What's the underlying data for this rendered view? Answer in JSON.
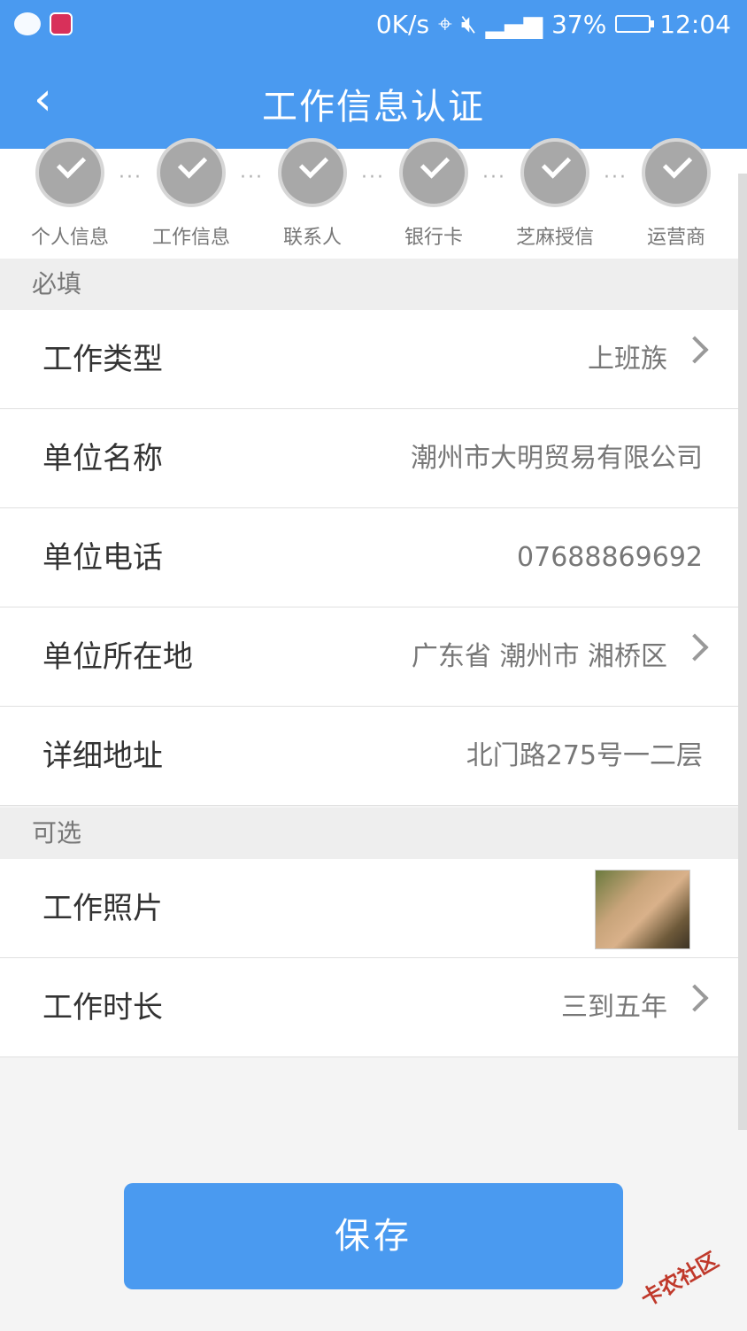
{
  "status_bar": {
    "speed": "0K/s",
    "battery_percent": "37%",
    "time": "12:04"
  },
  "header": {
    "title": "工作信息认证"
  },
  "steps": [
    {
      "label": "个人信息"
    },
    {
      "label": "工作信息"
    },
    {
      "label": "联系人"
    },
    {
      "label": "银行卡"
    },
    {
      "label": "芝麻授信"
    },
    {
      "label": "运营商"
    }
  ],
  "sections": {
    "required": "必填",
    "optional": "可选"
  },
  "fields": {
    "work_type": {
      "label": "工作类型",
      "value": "上班族"
    },
    "company_name": {
      "label": "单位名称",
      "value": "潮州市大明贸易有限公司"
    },
    "company_phone": {
      "label": "单位电话",
      "value": "07688869692"
    },
    "company_location": {
      "label": "单位所在地",
      "value": "广东省 潮州市 湘桥区"
    },
    "address": {
      "label": "详细地址",
      "value": "北门路275号一二层"
    },
    "work_photo": {
      "label": "工作照片"
    },
    "work_duration": {
      "label": "工作时长",
      "value": "三到五年"
    }
  },
  "save_button": "保存",
  "watermark": "卡农社区"
}
